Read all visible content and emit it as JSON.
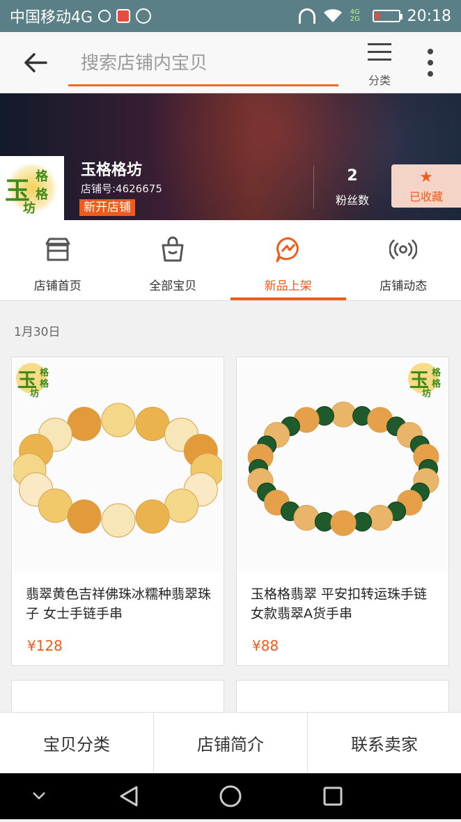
{
  "status_bar": {
    "carrier": "中国移动4G",
    "time": "20:18",
    "network": "4G 2G"
  },
  "header": {
    "search_placeholder": "搜索店铺内宝贝",
    "category_label": "分类"
  },
  "shop": {
    "name": "玉格格坊",
    "shop_id": "店铺号:4626675",
    "badge": "新开店铺",
    "fans_count": "2",
    "fans_label": "粉丝数",
    "favorite_label": "已收藏",
    "logo_text": {
      "yu": "玉",
      "ge1": "格",
      "ge2": "格",
      "fang": "坊"
    }
  },
  "tabs": [
    {
      "label": "店铺首页",
      "icon": "storefront-icon"
    },
    {
      "label": "全部宝贝",
      "icon": "shopping-bag-icon"
    },
    {
      "label": "新品上架",
      "icon": "new-arrivals-icon"
    },
    {
      "label": "店铺动态",
      "icon": "broadcast-icon"
    }
  ],
  "active_tab": "新品上架",
  "date": "1月30日",
  "products": [
    {
      "title": "翡翠黄色吉祥佛珠冰糯种翡翠珠子 女士手链手串",
      "price": "¥128"
    },
    {
      "title": "玉格格翡翠 平安扣转运珠手链 女款翡翠A货手串",
      "price": "¥88"
    }
  ],
  "bottom_bar": {
    "category": "宝贝分类",
    "intro": "店铺简介",
    "contact": "联系卖家"
  },
  "colors": {
    "accent": "#f05a1a",
    "status_bar": "#5a7f86",
    "logo_green": "#3f8a1a"
  }
}
